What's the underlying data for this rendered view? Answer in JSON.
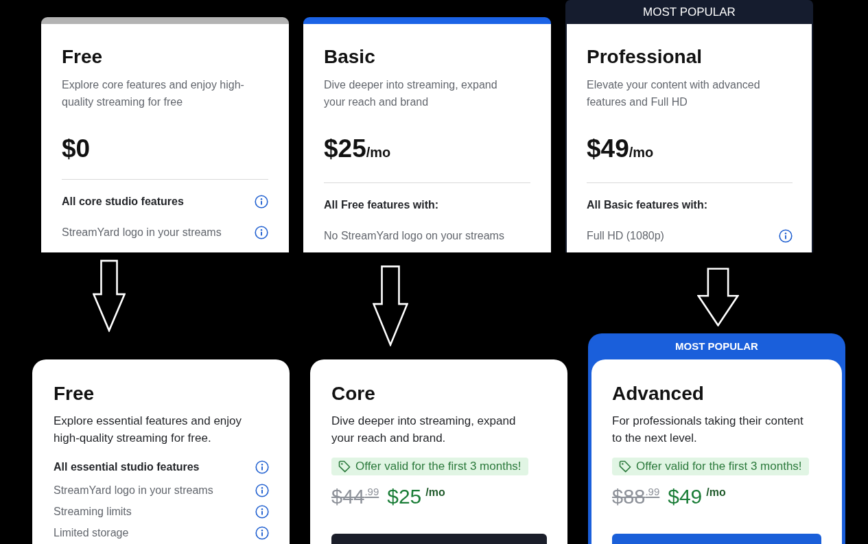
{
  "old_plans": [
    {
      "name": "Free",
      "color": "#b3b3b3",
      "description": "Explore core features and enjoy high-quality streaming for free",
      "price": "$0",
      "features": [
        {
          "kind": "heading",
          "text": "All core studio features",
          "info": true
        },
        {
          "kind": "item",
          "text": "StreamYard logo in your streams",
          "info": true
        }
      ]
    },
    {
      "name": "Basic",
      "color": "#1b63e6",
      "description": "Dive deeper into streaming, expand your reach and brand",
      "price": "$25",
      "period": "/mo",
      "features": [
        {
          "kind": "heading",
          "text": "All Free features with:",
          "info": false
        },
        {
          "kind": "item",
          "text": "No StreamYard logo on your streams",
          "info": false
        }
      ]
    },
    {
      "name": "Professional",
      "badge": "MOST POPULAR",
      "color": "#151c2e",
      "description": "Elevate your content with advanced features and Full HD",
      "price": "$49",
      "period": "/mo",
      "features": [
        {
          "kind": "heading",
          "text": "All Basic features with:",
          "info": false
        },
        {
          "kind": "item",
          "text": "Full HD (1080p)",
          "info": true
        }
      ]
    }
  ],
  "new_plans": [
    {
      "name": "Free",
      "description": "Explore essential features and enjoy high-quality streaming for free.",
      "features": [
        {
          "kind": "heading",
          "text": "All essential studio features",
          "info": true
        },
        {
          "kind": "item",
          "text": "StreamYard logo in your streams",
          "info": true
        },
        {
          "kind": "item",
          "text": "Streaming limits",
          "info": true
        },
        {
          "kind": "item",
          "text": "Limited storage",
          "info": true
        }
      ]
    },
    {
      "name": "Core",
      "description": "Dive deeper into streaming, expand your reach and brand.",
      "offer": "Offer valid for the first 3 months!",
      "old_price": "$44$^{.99}$",
      "price": "$25",
      "period": "/mo",
      "button": true
    },
    {
      "name": "Advanced",
      "badge": "MOST POPULAR",
      "description": "For professionals taking their content to the next level.",
      "offer": "Offer valid for the first 3 months!",
      "old_price": "$88$^{.99}$",
      "price": "$49",
      "period": "/mo",
      "button": true
    }
  ]
}
